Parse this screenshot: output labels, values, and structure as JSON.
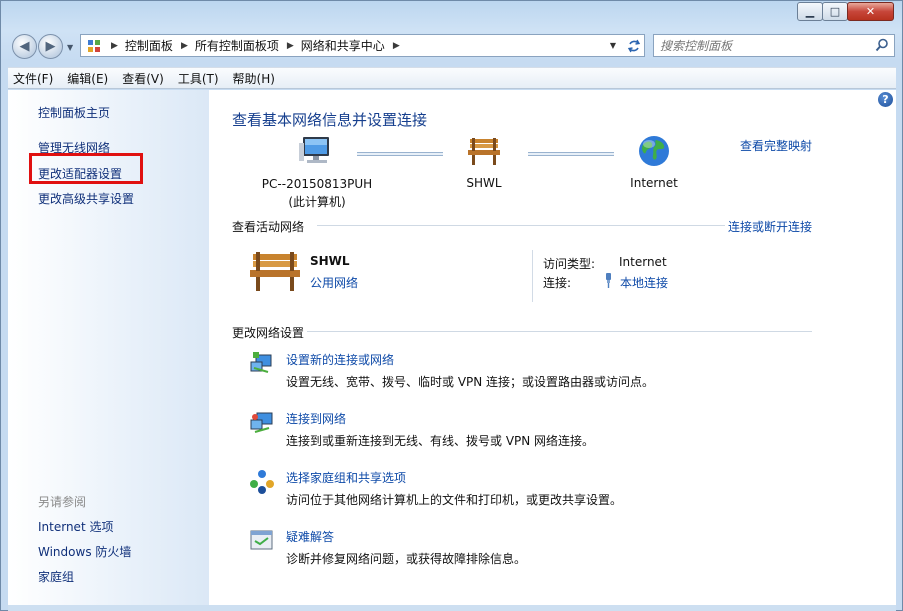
{
  "window": {
    "controls": {
      "minimize": "▁",
      "maximize": "□",
      "close": "✕"
    }
  },
  "address_bar": {
    "crumbs": [
      "控制面板",
      "所有控制面板项",
      "网络和共享中心"
    ],
    "search_placeholder": "搜索控制面板"
  },
  "menu": [
    "文件(F)",
    "编辑(E)",
    "查看(V)",
    "工具(T)",
    "帮助(H)"
  ],
  "sidebar": {
    "links": [
      "控制面板主页",
      "管理无线网络",
      "更改适配器设置",
      "更改高级共享设置"
    ],
    "see_also_heading": "另请参阅",
    "see_also": [
      "Internet 选项",
      "Windows 防火墙",
      "家庭组"
    ]
  },
  "main": {
    "title": "查看基本网络信息并设置连接",
    "full_map_link": "查看完整映射",
    "map": {
      "computer_name": "PC--20150813PUH",
      "computer_sub": "(此计算机)",
      "network_name": "SHWL",
      "internet_label": "Internet"
    },
    "active": {
      "heading": "查看活动网络",
      "connect_link": "连接或断开连接",
      "network_name": "SHWL",
      "network_type": "公用网络",
      "access_type_label": "访问类型:",
      "access_type_value": "Internet",
      "connections_label": "连接:",
      "connections_value": "本地连接"
    },
    "change": {
      "heading": "更改网络设置",
      "tasks": [
        {
          "link": "设置新的连接或网络",
          "desc": "设置无线、宽带、拨号、临时或 VPN 连接；或设置路由器或访问点。"
        },
        {
          "link": "连接到网络",
          "desc": "连接到或重新连接到无线、有线、拨号或 VPN 网络连接。"
        },
        {
          "link": "选择家庭组和共享选项",
          "desc": "访问位于其他网络计算机上的文件和打印机，或更改共享设置。"
        },
        {
          "link": "疑难解答",
          "desc": "诊断并修复网络问题，或获得故障排除信息。"
        }
      ]
    }
  },
  "colors": {
    "link": "#0e4aa8",
    "title": "#163f8e",
    "highlight_box": "#e01010"
  }
}
